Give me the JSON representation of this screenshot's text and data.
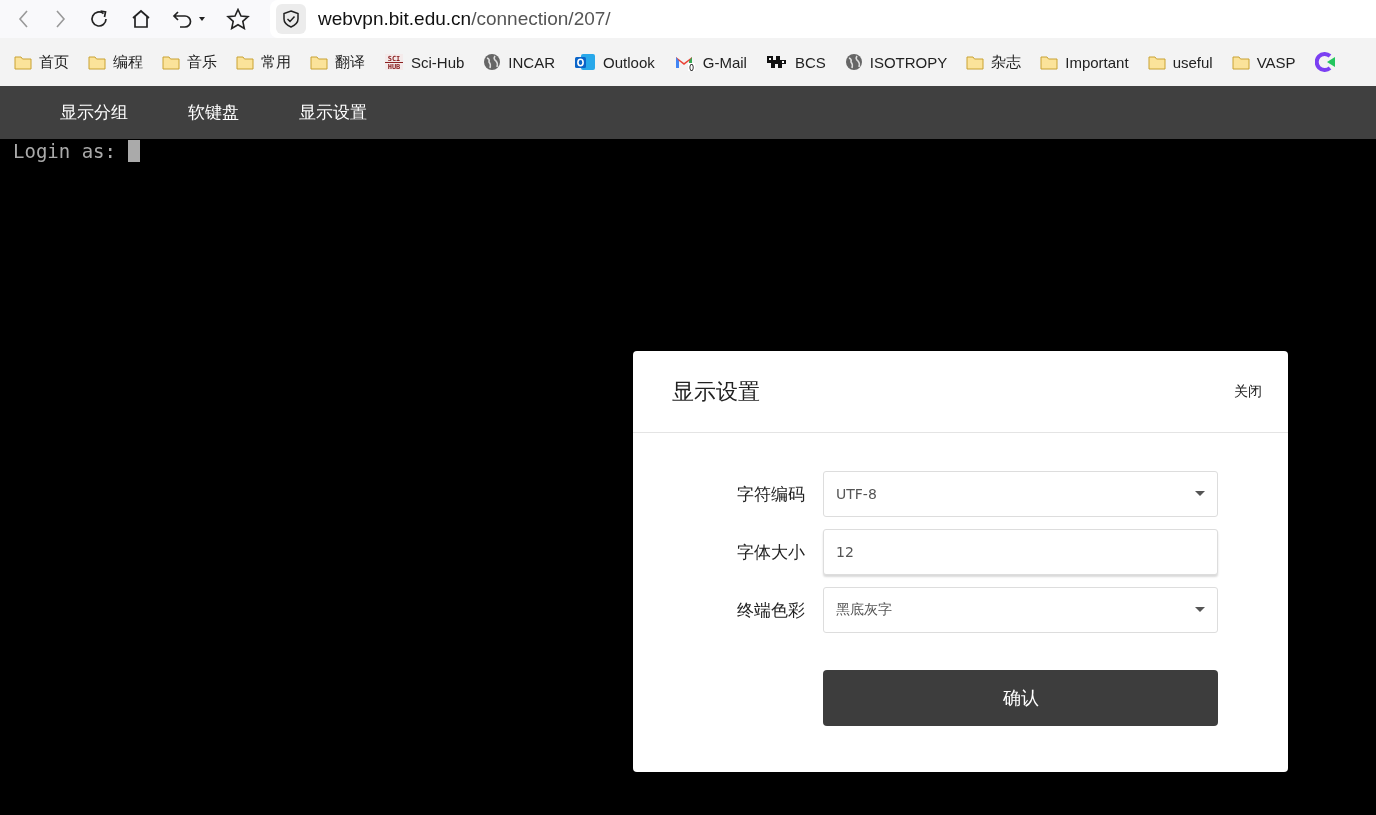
{
  "browser": {
    "url_host": "webvpn.bit.edu.cn",
    "url_path": "/connection/207/"
  },
  "bookmarks": [
    {
      "kind": "folder",
      "label": "首页"
    },
    {
      "kind": "folder",
      "label": "编程"
    },
    {
      "kind": "folder",
      "label": "音乐"
    },
    {
      "kind": "folder",
      "label": "常用"
    },
    {
      "kind": "folder",
      "label": "翻译"
    },
    {
      "kind": "scihub",
      "label": "Sci-Hub",
      "logo_text": [
        "SCI",
        "HUB"
      ]
    },
    {
      "kind": "globe",
      "label": "INCAR"
    },
    {
      "kind": "outlook",
      "label": "Outlook"
    },
    {
      "kind": "gmail",
      "label": "G-Mail",
      "badge": "0"
    },
    {
      "kind": "bcs",
      "label": "BCS"
    },
    {
      "kind": "globe",
      "label": "ISOTROPY"
    },
    {
      "kind": "folder",
      "label": "杂志"
    },
    {
      "kind": "folder",
      "label": "Important"
    },
    {
      "kind": "folder",
      "label": "useful"
    },
    {
      "kind": "folder",
      "label": "VASP"
    },
    {
      "kind": "app"
    }
  ],
  "nav": [
    "显示分组",
    "软键盘",
    "显示设置"
  ],
  "terminal": {
    "prompt": "Login as:"
  },
  "dialog": {
    "title": "显示设置",
    "close": "关闭",
    "fields": [
      {
        "kind": "select",
        "label": "字符编码",
        "value": "UTF-8"
      },
      {
        "kind": "input",
        "label": "字体大小",
        "value": "12"
      },
      {
        "kind": "select",
        "label": "终端色彩",
        "value": "黑底灰字"
      }
    ],
    "confirm": "确认"
  }
}
